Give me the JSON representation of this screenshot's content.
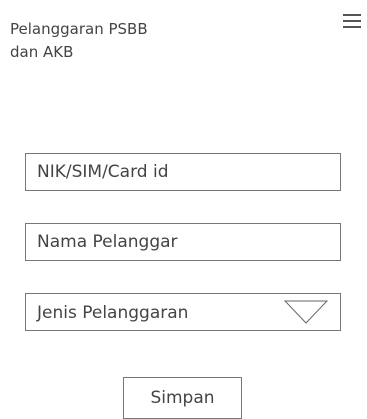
{
  "header": {
    "title": "Pelanggaran PSBB\ndan AKB",
    "menu_icon": "hamburger-menu-icon"
  },
  "form": {
    "nik_placeholder": "NIK/SIM/Card id",
    "nama_placeholder": "Nama Pelanggar",
    "jenis_value": "Jenis Pelanggaran",
    "jenis_icon": "triangle-down-icon",
    "save_label": "Simpan"
  }
}
